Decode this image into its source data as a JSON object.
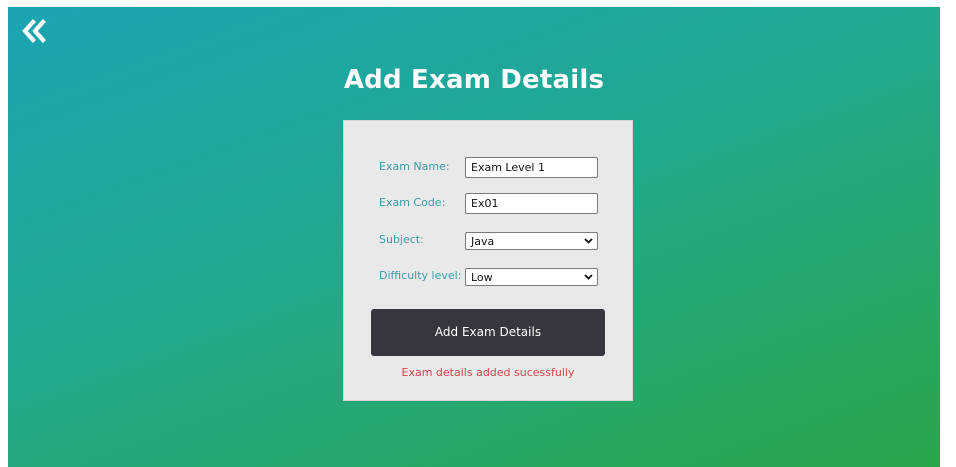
{
  "back_icon": "double-chevron-left-icon",
  "page": {
    "title": "Add Exam Details"
  },
  "form": {
    "exam_name": {
      "label": "Exam Name:",
      "value": "Exam Level 1"
    },
    "exam_code": {
      "label": "Exam Code:",
      "value": "Ex01"
    },
    "subject": {
      "label": "Subject:",
      "selected": "Java"
    },
    "difficulty": {
      "label": "Difficulty level:",
      "selected": "Low"
    },
    "submit_label": "Add Exam Details",
    "status_message": "Exam details added sucessfully"
  },
  "colors": {
    "gradient_start": "#1ba3b2",
    "gradient_end": "#2aa64a",
    "label_color": "#3d9aa8",
    "button_bg": "#36363e",
    "error_color": "#d4474d"
  }
}
